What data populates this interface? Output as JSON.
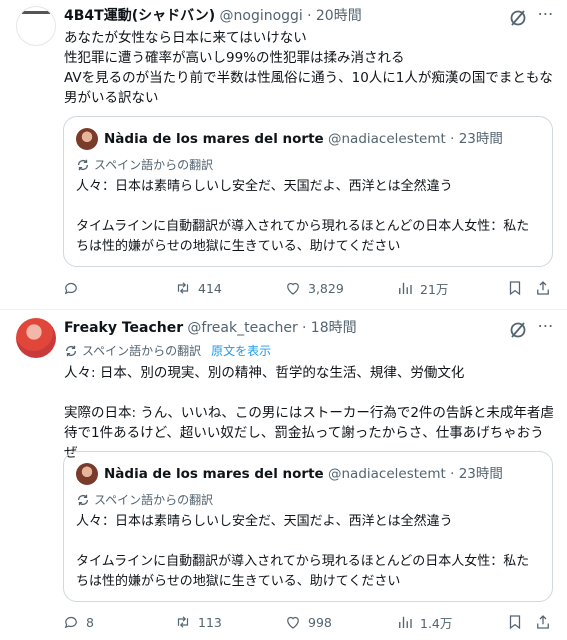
{
  "tweets": [
    {
      "name": "4B4T運動(シャドバン)",
      "handle": "@noginoggi",
      "time": "20時間",
      "text": "あなたが女性なら日本に来てはいけない\n性犯罪に遭う確率が高いし99%の性犯罪は揉み消される\nAVを見るのが当たり前で半数は性風俗に通う、10人に1人が痴漢の国でまともな\n男がいる訳ない",
      "quote": {
        "name": "Nàdia de los mares del norte",
        "handle": "@nadiacelestemt",
        "time": "23時間",
        "translate_label": "スペイン語からの翻訳",
        "text": "人々：日本は素晴らしいし安全だ、天国だよ、西洋とは全然違う\n\nタイムラインに自動翻訳が導入されてから現れるほとんどの日本人女性：私た\nちは性的嫌がらせの地獄に生きている、助けてください"
      },
      "actions": {
        "replies": "",
        "retweets": "414",
        "likes": "3,829",
        "views": "21万"
      }
    },
    {
      "name": "Freaky Teacher",
      "handle": "@freak_teacher",
      "time": "18時間",
      "translate_label": "スペイン語からの翻訳",
      "translate_link": "原文を表示",
      "text": "人々: 日本、別の現実、別の精神、哲学的な生活、規律、労働文化\n\n実際の日本: うん、いいね、この男にはストーカー行為で2件の告訴と未成年者虐\n待で1件あるけど、超いい奴だし、罰金払って謝ったからさ、仕事あげちゃおうぜ",
      "quote": {
        "name": "Nàdia de los mares del norte",
        "handle": "@nadiacelestemt",
        "time": "23時間",
        "translate_label": "スペイン語からの翻訳",
        "text": "人々：日本は素晴らしいし安全だ、天国だよ、西洋とは全然違う\n\nタイムラインに自動翻訳が導入されてから現れるほとんどの日本人女性：私た\nちは性的嫌がらせの地獄に生きている、助けてください"
      },
      "actions": {
        "replies": "8",
        "retweets": "113",
        "likes": "998",
        "views": "1.4万"
      }
    }
  ],
  "colors": {
    "text": "#0f1419",
    "muted": "#536471",
    "link": "#1d9bf0",
    "border": "#cfd9de"
  },
  "separator": "·"
}
